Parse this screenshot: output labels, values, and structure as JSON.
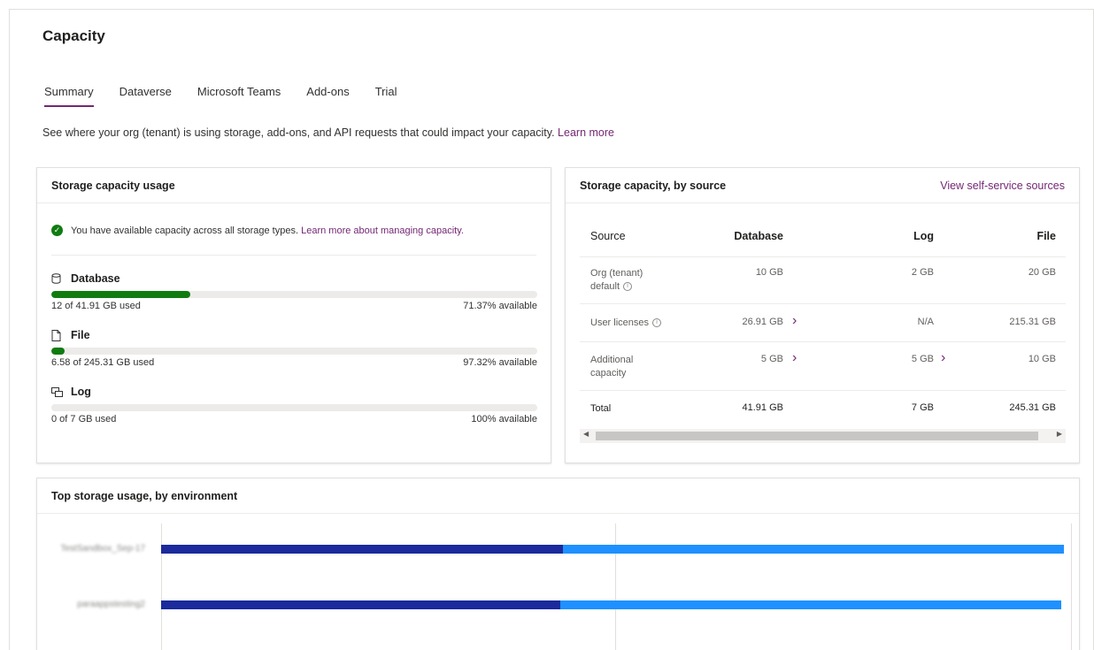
{
  "page": {
    "title": "Capacity"
  },
  "tabs": [
    {
      "label": "Summary",
      "active": true
    },
    {
      "label": "Dataverse",
      "active": false
    },
    {
      "label": "Microsoft Teams",
      "active": false
    },
    {
      "label": "Add-ons",
      "active": false
    },
    {
      "label": "Trial",
      "active": false
    }
  ],
  "intro": {
    "text": "See where your org (tenant) is using storage, add-ons, and API requests that could impact your capacity.",
    "link": "Learn more"
  },
  "usage": {
    "title": "Storage capacity usage",
    "status_text": "You have available capacity across all storage types.",
    "status_link": "Learn more about managing capacity.",
    "meters": [
      {
        "name": "Database",
        "icon": "database-icon",
        "used_text": "12 of 41.91 GB used",
        "available_text": "71.37% available",
        "used_fraction": 0.2863
      },
      {
        "name": "File",
        "icon": "file-icon",
        "used_text": "6.58 of 245.31 GB used",
        "available_text": "97.32% available",
        "used_fraction": 0.0268
      },
      {
        "name": "Log",
        "icon": "log-icon",
        "used_text": "0 of 7 GB used",
        "available_text": "100% available",
        "used_fraction": 0
      }
    ],
    "fill_color": "#107c10"
  },
  "source": {
    "title": "Storage capacity, by source",
    "link": "View self-service sources",
    "columns": [
      "Source",
      "Database",
      "Log",
      "File"
    ],
    "rows": [
      {
        "source": "Org (tenant) default",
        "info": true,
        "database": "10 GB",
        "log": "2 GB",
        "file": "20 GB",
        "db_chevron": false,
        "log_chevron": false
      },
      {
        "source": "User licenses",
        "info": true,
        "database": "26.91 GB",
        "log": "N/A",
        "file": "215.31 GB",
        "db_chevron": true,
        "log_chevron": false
      },
      {
        "source": "Additional capacity",
        "info": false,
        "database": "5 GB",
        "log": "5 GB",
        "file": "10 GB",
        "db_chevron": true,
        "log_chevron": true
      },
      {
        "source": "Total",
        "info": false,
        "database": "41.91 GB",
        "log": "7 GB",
        "file": "245.31 GB",
        "db_chevron": false,
        "log_chevron": false
      }
    ]
  },
  "env": {
    "title": "Top storage usage, by environment",
    "colors": {
      "database": "#1b2a9c",
      "file": "#1e90ff"
    },
    "rows": [
      {
        "label": "TestSandbox_Sep-17",
        "database_fraction": 0.442,
        "file_fraction": 0.551
      },
      {
        "label": "paraappstesting2",
        "database_fraction": 0.439,
        "file_fraction": 0.551
      }
    ]
  }
}
